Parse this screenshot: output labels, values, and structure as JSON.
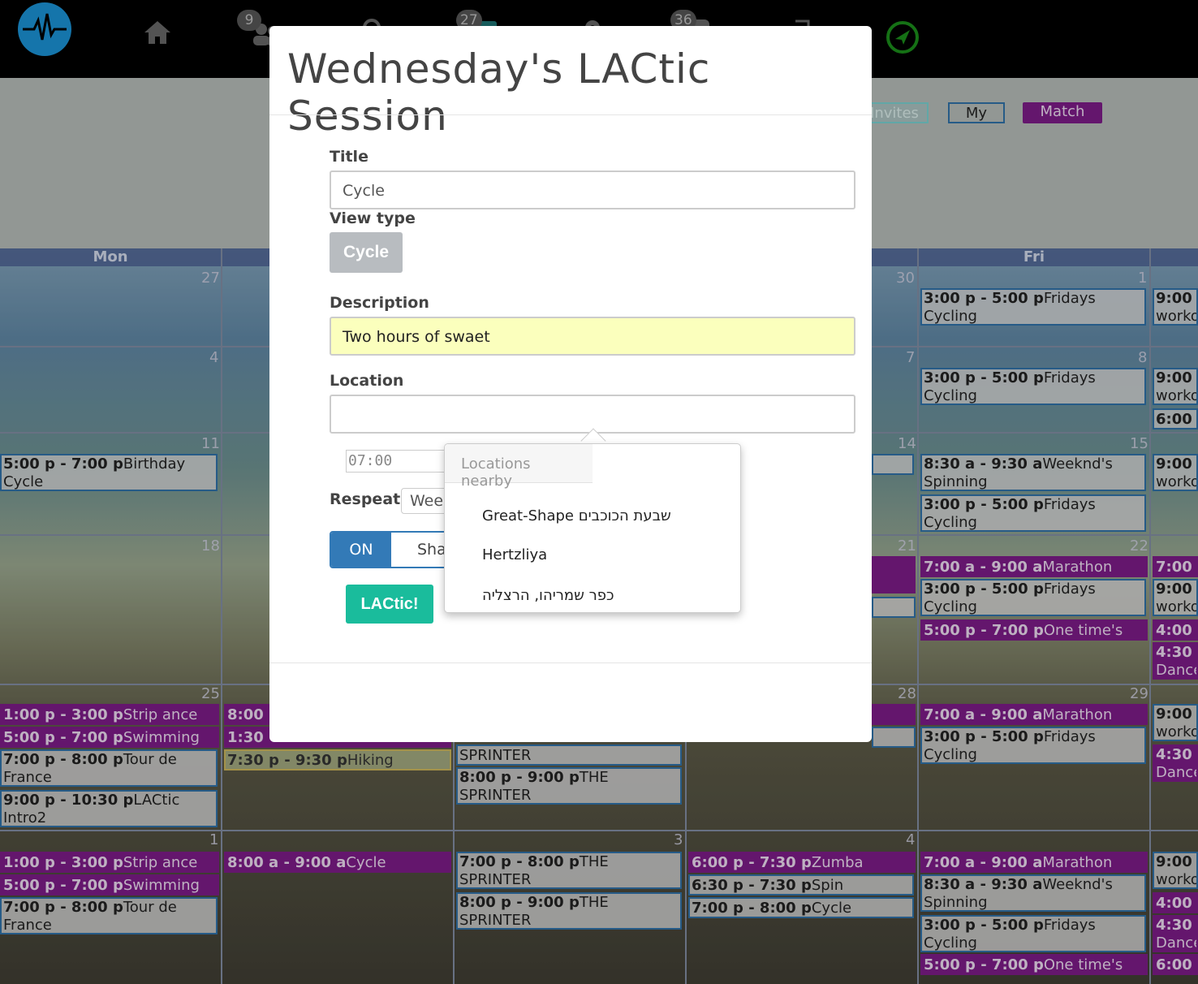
{
  "navbar": {
    "badges": {
      "friends": "9",
      "calendar": "27",
      "messages": "36"
    }
  },
  "view_buttons": {
    "invites": "Invites",
    "my": "My",
    "match": "Match"
  },
  "calendar": {
    "headers": {
      "mon": "Mon",
      "fri": "Fri"
    },
    "day_numbers": [
      "27",
      "30",
      "1",
      "4",
      "7",
      "8",
      "11",
      "14",
      "15",
      "18",
      "21",
      "22",
      "25",
      "28",
      "29",
      "1",
      "3",
      "4"
    ],
    "events": {
      "e1": {
        "time": "3:00 p - 5:00 p",
        "title": "Fridays Cycling"
      },
      "e2": {
        "time": "9:00",
        "title": "worko"
      },
      "e3": {
        "time": "3:00 p - 5:00 p",
        "title": "Fridays Cycling"
      },
      "e4": {
        "time": "9:00",
        "title": "worko"
      },
      "e5": {
        "time": "6:00",
        "title": ""
      },
      "e6": {
        "time": "5:00 p - 7:00 p",
        "title": "Birthday Cycle"
      },
      "e7": {
        "time": "8:30 a - 9:30 a",
        "title": "Weeknd's Spinning"
      },
      "e8": {
        "time": "9:00",
        "title": "worko"
      },
      "e9": {
        "time": "3:00 p - 5:00 p",
        "title": "Fridays Cycling"
      },
      "e10": {
        "time": "7:00 a - 9:00 a",
        "title": "Marathon"
      },
      "e11": {
        "time": "7:00",
        "title": ""
      },
      "e12": {
        "time": "3:00 p - 5:00 p",
        "title": "Fridays Cycling"
      },
      "e13": {
        "time": "9:00",
        "title": "worko"
      },
      "e14": {
        "time": "5:00 p - 7:00 p",
        "title": "One time's"
      },
      "e15": {
        "time": "4:00",
        "title": ""
      },
      "e16": {
        "time": "4:30",
        "title": "Dance"
      },
      "e17": {
        "time": "1:00 p - 3:00 p",
        "title": "Strip ance"
      },
      "e18": {
        "time": "5:00 p - 7:00 p",
        "title": "Swimming"
      },
      "e19": {
        "time": "7:00 p - 8:00 p",
        "title": "Tour de France"
      },
      "e20": {
        "time": "9:00 p - 10:30 p",
        "title": "LACtic Intro2"
      },
      "e21": {
        "time": "8:00",
        "title": ""
      },
      "e22": {
        "time": "1:30",
        "title": ""
      },
      "e23": {
        "time": "7:30 p - 9:30 p",
        "title": "Hiking"
      },
      "e24": {
        "time": "",
        "title": "SPRINTER"
      },
      "e25": {
        "time": "8:00 p - 9:00 p",
        "title": "THE SPRINTER"
      },
      "e26": {
        "time": "7:00 a - 9:00 a",
        "title": "Marathon"
      },
      "e27": {
        "time": "3:00 p - 5:00 p",
        "title": "Fridays Cycling"
      },
      "e28": {
        "time": "9:00",
        "title": "worko"
      },
      "e29": {
        "time": "4:30",
        "title": "Dance"
      },
      "e30": {
        "time": "1:00 p - 3:00 p",
        "title": "Strip ance"
      },
      "e31": {
        "time": "5:00 p - 7:00 p",
        "title": "Swimming"
      },
      "e32": {
        "time": "7:00 p - 8:00 p",
        "title": "Tour de France"
      },
      "e33": {
        "time": "8:00 a - 9:00 a",
        "title": "Cycle"
      },
      "e34": {
        "time": "7:00 p - 8:00 p",
        "title": "THE SPRINTER"
      },
      "e35": {
        "time": "8:00 p - 9:00 p",
        "title": "THE SPRINTER"
      },
      "e36": {
        "time": "6:00 p - 7:30 p",
        "title": "Zumba"
      },
      "e37": {
        "time": "6:30 p - 7:30 p",
        "title": "Spin"
      },
      "e38": {
        "time": "7:00 p - 8:00 p",
        "title": "Cycle"
      },
      "e39": {
        "time": "7:00 a - 9:00 a",
        "title": "Marathon"
      },
      "e40": {
        "time": "8:30 a - 9:30 a",
        "title": "Weeknd's Spinning"
      },
      "e41": {
        "time": "3:00 p - 5:00 p",
        "title": "Fridays Cycling"
      },
      "e42": {
        "time": "5:00 p - 7:00 p",
        "title": "One time's"
      },
      "e43": {
        "time": "9:00",
        "title": "worko"
      },
      "e44": {
        "time": "4:00",
        "title": ""
      },
      "e45": {
        "time": "4:30",
        "title": "Dance"
      },
      "e46": {
        "time": "6:00",
        "title": ""
      }
    }
  },
  "modal": {
    "title": "Wednesday's LACtic Session",
    "title_label": "Title",
    "title_value": "Cycle",
    "view_type_label": "View type",
    "view_type_button": "Cycle",
    "description_label": "Description",
    "description_value": "Two hours of swaet",
    "location_label": "Location",
    "location_value": "",
    "time_value": "07:00",
    "repeat_label": "Respeat",
    "repeat_value": "Weekly",
    "toggle_on": "ON",
    "toggle_off": "Share",
    "submit_label": "LACtic!"
  },
  "location_popover": {
    "header": "Locations nearby",
    "items": [
      "Great-Shape שבעת הכוכבים",
      "Hertzliya",
      "כפר שמריהו, הרצליה"
    ]
  },
  "colors": {
    "accent_blue": "#337ab7",
    "submit_green": "#1abc9c",
    "event_purple": "#7b1c86"
  },
  "icons": [
    "pulse-logo-icon",
    "home-icon",
    "users-icon",
    "search-icon",
    "calendar-icon",
    "gear-icon",
    "chat-icon",
    "logout-icon",
    "navigation-icon"
  ]
}
